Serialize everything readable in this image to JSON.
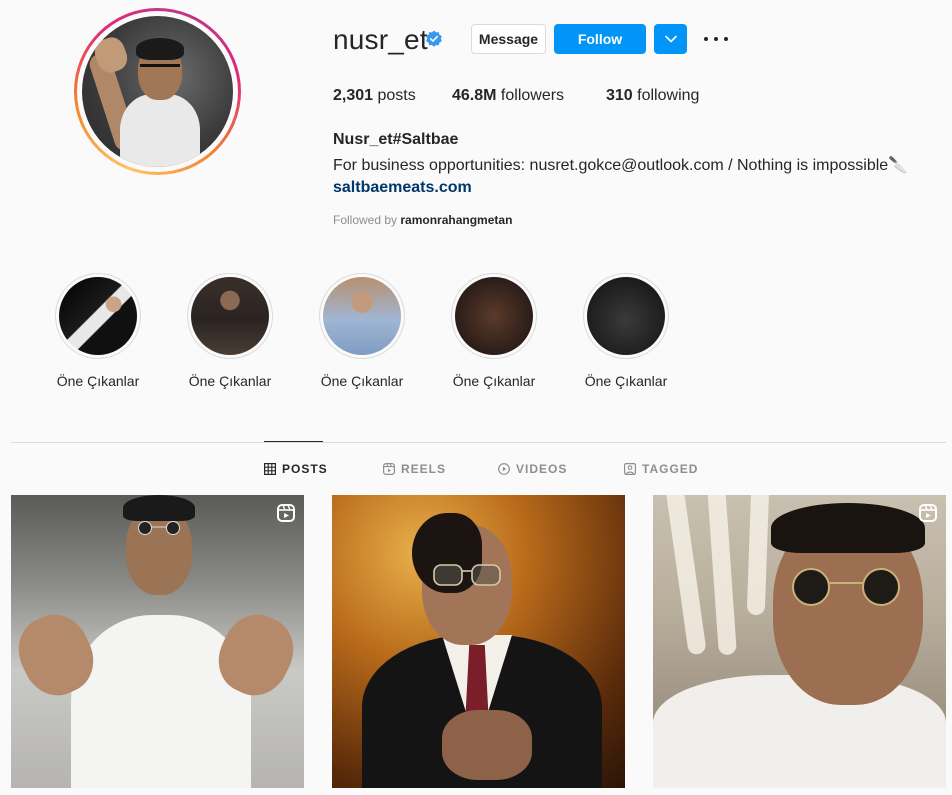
{
  "profile": {
    "username": "nusr_et",
    "verified": true,
    "buttons": {
      "message": "Message",
      "follow": "Follow"
    },
    "stats": {
      "posts_count": "2,301",
      "posts_label": "posts",
      "followers_count": "46.8M",
      "followers_label": "followers",
      "following_count": "310",
      "following_label": "following"
    },
    "full_name": "Nusr_et#Saltbae",
    "bio": "For business opportunities: nusret.gokce@outlook.com / Nothing is impossible🔪",
    "website": "saltbaemeats.com",
    "followed_by_prefix": "Followed by",
    "followed_by_user": "ramonrahangmetan"
  },
  "highlights": [
    {
      "label": "Öne Çıkanlar"
    },
    {
      "label": "Öne Çıkanlar"
    },
    {
      "label": "Öne Çıkanlar"
    },
    {
      "label": "Öne Çıkanlar"
    },
    {
      "label": "Öne Çıkanlar"
    }
  ],
  "tabs": [
    {
      "label": "POSTS",
      "icon": "grid-icon",
      "active": true
    },
    {
      "label": "REELS",
      "icon": "reels-icon",
      "active": false
    },
    {
      "label": "VIDEOS",
      "icon": "play-icon",
      "active": false
    },
    {
      "label": "TAGGED",
      "icon": "tag-icon",
      "active": false
    }
  ],
  "posts": [
    {
      "type": "reel",
      "badge_icon": "reels-icon"
    },
    {
      "type": "photo"
    },
    {
      "type": "reel",
      "badge_icon": "reels-icon"
    }
  ],
  "colors": {
    "follow_button": "#0095f6",
    "link": "#00376b",
    "verified_badge": "#3897f0",
    "background": "#fafafa"
  }
}
